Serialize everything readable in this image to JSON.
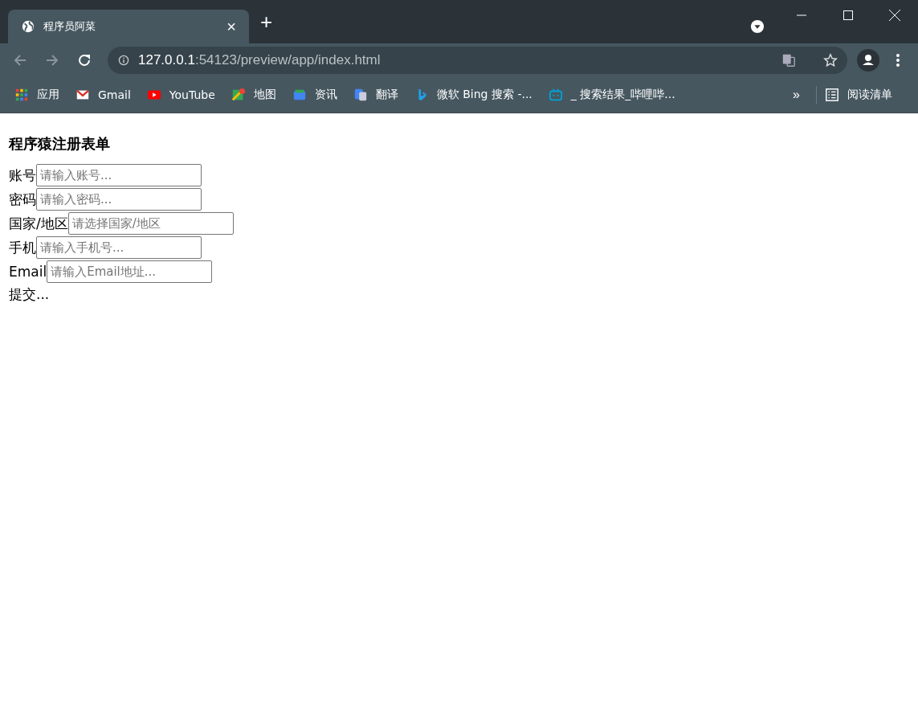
{
  "tab": {
    "title": "程序员阿菜",
    "close": "×",
    "new_tab": "+"
  },
  "address": {
    "host": "127.0.0.1",
    "path": ":54123/preview/app/index.html"
  },
  "bookmarks": [
    {
      "label": "应用"
    },
    {
      "label": "Gmail"
    },
    {
      "label": "YouTube"
    },
    {
      "label": "地图"
    },
    {
      "label": "资讯"
    },
    {
      "label": "翻译"
    },
    {
      "label": "微软 Bing 搜索 -..."
    },
    {
      "label": "_ 搜索结果_哔哩哔..."
    }
  ],
  "bookmarks_more": "»",
  "reading_list": "阅读清单",
  "page": {
    "heading": "程序猿注册表单",
    "fields": [
      {
        "label": "账号",
        "placeholder": "请输入账号..."
      },
      {
        "label": "密码",
        "placeholder": "请输入密码..."
      },
      {
        "label": "国家/地区",
        "placeholder": "请选择国家/地区"
      },
      {
        "label": "手机",
        "placeholder": "请输入手机号..."
      },
      {
        "label": "Email",
        "placeholder": "请输入Email地址..."
      }
    ],
    "submit": "提交..."
  }
}
